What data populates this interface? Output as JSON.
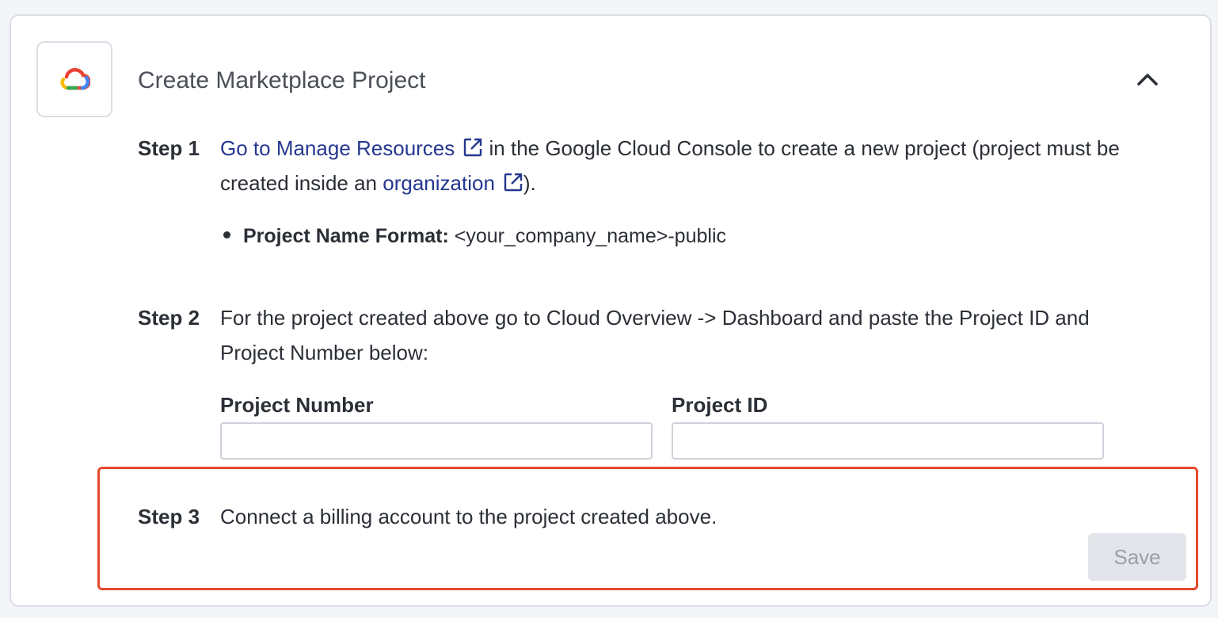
{
  "panel": {
    "title": "Create Marketplace Project",
    "logo_icon": "google-cloud-logo",
    "collapse_icon": "chevron-up-icon"
  },
  "step1": {
    "label": "Step 1",
    "link1": "Go to Manage Resources",
    "text1": " in the Google Cloud Console to create a new project (project must be created inside an ",
    "link2": "organization",
    "text2": ").",
    "bullet_label": "Project Name Format:",
    "bullet_value": " <your_company_name>-public"
  },
  "step2": {
    "label": "Step 2",
    "text": "For the project created above go to Cloud Overview -> Dashboard and paste the Project ID and Project Number below:",
    "project_number_label": "Project Number",
    "project_number_value": "",
    "project_id_label": "Project ID",
    "project_id_value": ""
  },
  "step3": {
    "label": "Step 3",
    "text": "Connect a billing account to the project created above."
  },
  "actions": {
    "save_label": "Save"
  },
  "colors": {
    "link": "#25378f",
    "highlight_border": "#e8482c",
    "save_disabled_bg": "#e3e5ea"
  }
}
